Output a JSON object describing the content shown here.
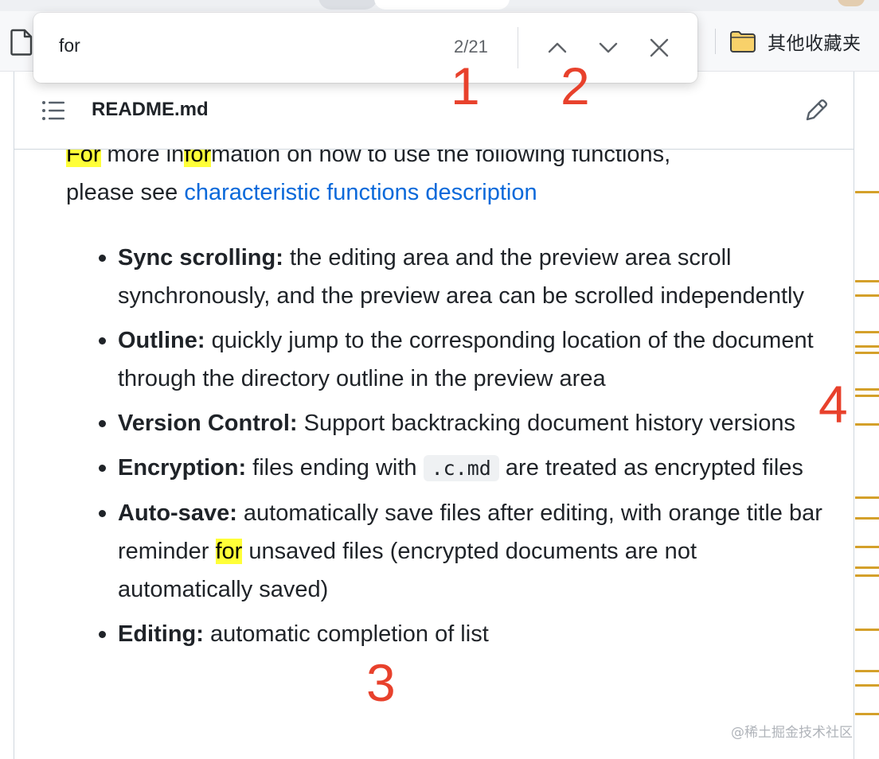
{
  "browser": {
    "bookmark_folder_label": "其他收藏夹",
    "page_icon": "document-icon",
    "folder_icon": "folder-icon"
  },
  "find_bar": {
    "query": "for",
    "match_count": "2/21",
    "prev_icon": "chevron-up-icon",
    "next_icon": "chevron-down-icon",
    "close_icon": "close-icon"
  },
  "file": {
    "name": "README.md",
    "outline_icon": "list-icon",
    "edit_icon": "pencil-icon"
  },
  "intro": {
    "match_1": "For",
    "text_1": " more in",
    "match_2": "for",
    "text_2": "mation on how to use the following functions,",
    "text_3": "please see ",
    "link": "characteristic functions description"
  },
  "features": [
    {
      "title": "Sync scrolling:",
      "desc": " the editing area and the preview area scroll synchronously, and the preview area can be scrolled independently"
    },
    {
      "title": "Outline:",
      "desc": " quickly jump to the corresponding location of the document through the directory outline in the preview area"
    },
    {
      "title": "Version Control:",
      "desc": " Support backtracking document history versions"
    },
    {
      "title": "Encryption:",
      "desc_before": " files ending with ",
      "code": ".c.md",
      "desc_after": " are treated as encrypted files"
    },
    {
      "title": "Auto-save:",
      "desc_before": " automatically save files after editing, with orange title bar reminder ",
      "match": "for",
      "desc_after": " unsaved files (encrypted documents are not automatically saved)"
    },
    {
      "title": "Editing:",
      "desc": " automatic completion of list"
    }
  ],
  "annotations": [
    "1",
    "2",
    "3",
    "4"
  ],
  "colors": {
    "highlight": "#ffff38",
    "link": "#0969da",
    "annotation": "#e8412c",
    "scroll_tick": "#d4a02a"
  },
  "watermark": "@稀土掘金技术社区"
}
